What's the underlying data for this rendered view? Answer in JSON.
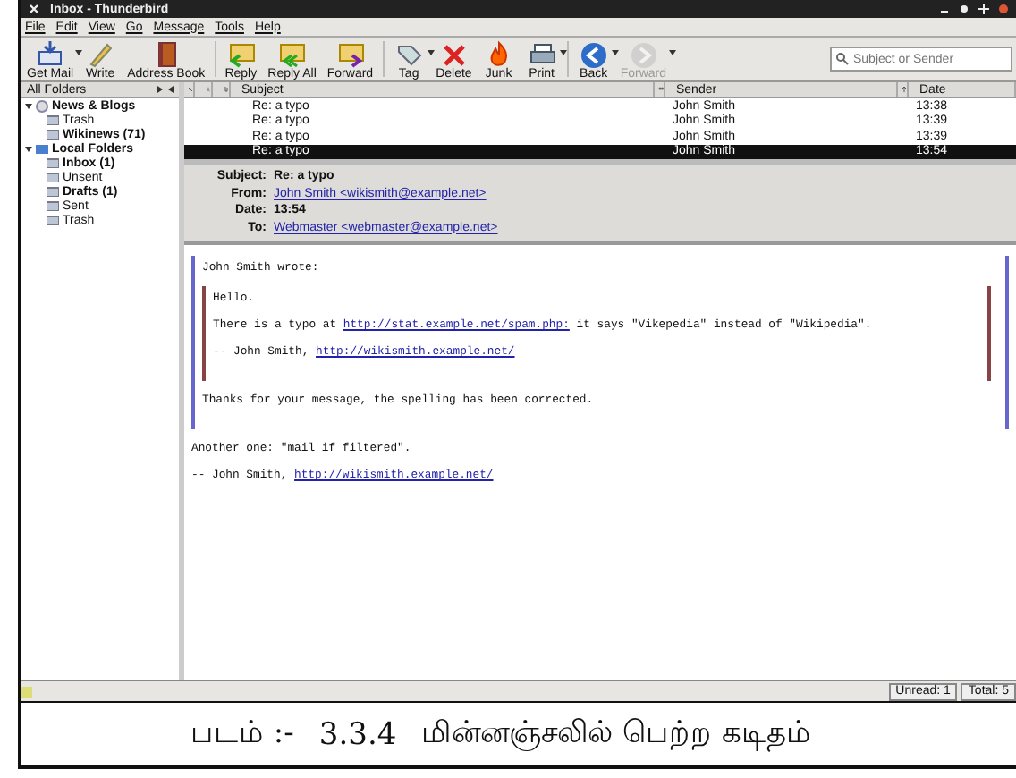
{
  "window": {
    "title": "Inbox - Thunderbird"
  },
  "menu": [
    "File",
    "Edit",
    "View",
    "Go",
    "Message",
    "Tools",
    "Help"
  ],
  "toolbar": [
    {
      "label": "Get Mail",
      "menu": true,
      "disabled": false
    },
    {
      "label": "Write",
      "menu": false,
      "disabled": false
    },
    {
      "label": "Address Book",
      "menu": false,
      "disabled": false
    },
    {
      "label": "Reply",
      "menu": false,
      "disabled": false
    },
    {
      "label": "Reply All",
      "menu": false,
      "disabled": false
    },
    {
      "label": "Forward",
      "menu": false,
      "disabled": false
    },
    {
      "label": "Tag",
      "menu": true,
      "disabled": false
    },
    {
      "label": "Delete",
      "menu": false,
      "disabled": false
    },
    {
      "label": "Junk",
      "menu": false,
      "disabled": false
    },
    {
      "label": "Print",
      "menu": true,
      "disabled": false
    },
    {
      "label": "Back",
      "menu": true,
      "disabled": false
    },
    {
      "label": "Forward",
      "menu": true,
      "disabled": true
    }
  ],
  "search": {
    "placeholder": "Subject or Sender"
  },
  "folders": {
    "header": "All Folders",
    "items": [
      {
        "label": "News & Blogs",
        "bold": true,
        "expanded": true,
        "children": [
          {
            "label": "Trash",
            "bold": false
          },
          {
            "label": "Wikinews (71)",
            "bold": true
          }
        ]
      },
      {
        "label": "Local Folders",
        "bold": true,
        "expanded": true,
        "children": [
          {
            "label": "Inbox (1)",
            "bold": true
          },
          {
            "label": "Unsent",
            "bold": false
          },
          {
            "label": "Drafts (1)",
            "bold": true
          },
          {
            "label": "Sent",
            "bold": false
          },
          {
            "label": "Trash",
            "bold": false
          }
        ]
      }
    ]
  },
  "message_list": {
    "columns": [
      "Subject",
      "Sender",
      "Date"
    ],
    "rows": [
      {
        "subject": "Re: a typo",
        "sender": "John Smith",
        "date": "13:38",
        "selected": false
      },
      {
        "subject": "Re: a typo",
        "sender": "John Smith",
        "date": "13:39",
        "selected": false
      },
      {
        "subject": "Re: a typo",
        "sender": "John Smith",
        "date": "13:39",
        "selected": false
      },
      {
        "subject": "Re: a typo",
        "sender": "John Smith",
        "date": "13:54",
        "selected": true
      }
    ]
  },
  "headers": [
    {
      "label": "Subject:",
      "value": "Re: a typo",
      "link": false
    },
    {
      "label": "From:",
      "value": "John Smith <wikismith@example.net>",
      "link": true
    },
    {
      "label": "Date:",
      "value": "13:54",
      "link": false
    },
    {
      "label": "To:",
      "value": "Webmaster <webmaster@example.net>",
      "link": true
    }
  ],
  "body": [
    {
      "kind": "quote",
      "children": [
        {
          "kind": "line",
          "parts": [
            {
              "kind": "text",
              "text": "John Smith wrote:"
            }
          ]
        },
        {
          "kind": "quote",
          "children": [
            {
              "kind": "line",
              "parts": [
                {
                  "kind": "text",
                  "text": "Hello."
                }
              ]
            },
            {
              "kind": "line",
              "parts": [
                {
                  "kind": "text",
                  "text": "There is a typo at "
                },
                {
                  "kind": "link",
                  "text": "http://stat.example.net/spam.php:"
                },
                {
                  "kind": "text",
                  "text": " it says \"Vikepedia\" instead of \"Wikipedia\"."
                }
              ]
            },
            {
              "kind": "line",
              "parts": [
                {
                  "kind": "text",
                  "text": "-- John Smith, "
                },
                {
                  "kind": "link",
                  "text": "http://wikismith.example.net/"
                }
              ]
            }
          ]
        },
        {
          "kind": "line",
          "parts": [
            {
              "kind": "text",
              "text": "Thanks for your message, the spelling has been corrected."
            }
          ]
        }
      ]
    },
    {
      "kind": "line",
      "parts": [
        {
          "kind": "text",
          "text": "Another one: \"mail if filtered\"."
        }
      ]
    },
    {
      "kind": "line",
      "parts": [
        {
          "kind": "text",
          "text": "-- John Smith, "
        },
        {
          "kind": "link",
          "text": "http://wikismith.example.net/"
        }
      ]
    }
  ],
  "status_bar": [
    "Unread: 1",
    "Total: 5"
  ],
  "caption": {
    "label": "படம் :-",
    "number": "3.3.4",
    "text": "மின்னஞ்சலில் பெற்ற கடிதம்"
  }
}
